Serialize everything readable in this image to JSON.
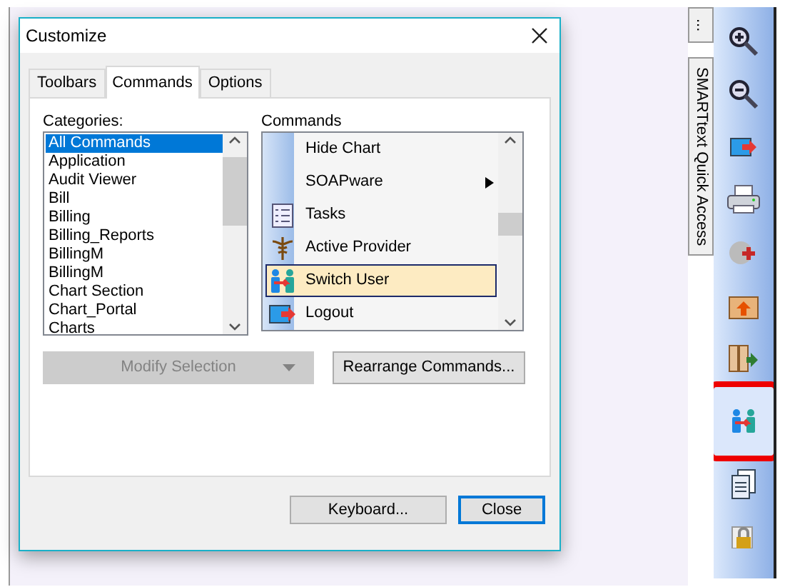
{
  "window": {
    "title": "Customize"
  },
  "tabs": [
    {
      "label": "Toolbars",
      "selected": false
    },
    {
      "label": "Commands",
      "selected": true
    },
    {
      "label": "Options",
      "selected": false
    }
  ],
  "categories": {
    "label": "Categories:",
    "items": [
      {
        "label": "All Commands",
        "selected": true
      },
      {
        "label": "Application",
        "selected": false
      },
      {
        "label": "Audit Viewer",
        "selected": false
      },
      {
        "label": "Bill",
        "selected": false
      },
      {
        "label": "Billing",
        "selected": false
      },
      {
        "label": "Billing_Reports",
        "selected": false
      },
      {
        "label": "BillingM",
        "selected": false
      },
      {
        "label": "BillingM",
        "selected": false
      },
      {
        "label": "Chart Section",
        "selected": false
      },
      {
        "label": "Chart_Portal",
        "selected": false
      },
      {
        "label": "Charts",
        "selected": false
      }
    ]
  },
  "commands": {
    "label": "Commands",
    "items": [
      {
        "label": "Hide Chart",
        "kind": "none",
        "submenu": false,
        "selected": false
      },
      {
        "label": "SOAPware",
        "kind": "none",
        "submenu": true,
        "selected": false
      },
      {
        "label": "Tasks",
        "kind": "tasks",
        "submenu": false,
        "selected": false
      },
      {
        "label": "Active Provider",
        "kind": "caduceus",
        "submenu": false,
        "selected": false
      },
      {
        "label": "Switch User",
        "kind": "switch-user",
        "submenu": false,
        "selected": true
      },
      {
        "label": "Logout",
        "kind": "logout",
        "submenu": false,
        "selected": false
      }
    ]
  },
  "actions": [
    {
      "label": "Modify Selection",
      "disabled": true,
      "dropdown": true
    },
    {
      "label": "Rearrange Commands...",
      "disabled": false,
      "dropdown": false
    }
  ],
  "footer_buttons": [
    {
      "label": "Keyboard...",
      "default": false
    },
    {
      "label": "Close",
      "default": true
    }
  ],
  "side_tabs": [
    {
      "label": "..."
    },
    {
      "label": "SMARTtext Quick Access"
    }
  ],
  "toolbar": [
    {
      "kind": "zoom-in",
      "highlighted": false
    },
    {
      "kind": "zoom-out",
      "highlighted": false
    },
    {
      "kind": "logout",
      "highlighted": false
    },
    {
      "kind": "printer",
      "highlighted": false
    },
    {
      "kind": "medical",
      "highlighted": false
    },
    {
      "kind": "folder-up",
      "highlighted": false
    },
    {
      "kind": "folder-in",
      "highlighted": false
    },
    {
      "kind": "switch-user",
      "highlighted": true
    },
    {
      "kind": "document",
      "highlighted": false
    },
    {
      "kind": "lock",
      "highlighted": false
    }
  ]
}
